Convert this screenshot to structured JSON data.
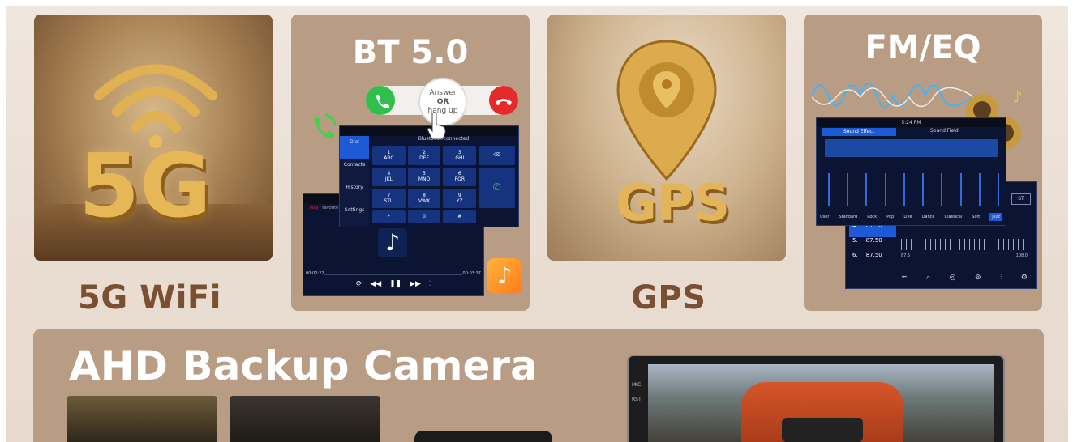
{
  "cards": {
    "wifi": {
      "big_text": "5G",
      "caption": "5G WiFi"
    },
    "bt": {
      "title": "BT 5.0",
      "answer_line1": "Answer",
      "answer_line2": "OR",
      "answer_line3": "hang up",
      "dial_header": "Bluetooth connected",
      "side_items": [
        "Dial",
        "Contacts",
        "History",
        "Settings"
      ],
      "keys": [
        {
          "num": "1",
          "letters": "ABC"
        },
        {
          "num": "2",
          "letters": "DEF"
        },
        {
          "num": "3",
          "letters": "GHI"
        },
        {
          "num": "4",
          "letters": "JKL"
        },
        {
          "num": "5",
          "letters": "MNO"
        },
        {
          "num": "6",
          "letters": "PQR"
        },
        {
          "num": "7",
          "letters": "STU"
        },
        {
          "num": "8",
          "letters": "VWX"
        },
        {
          "num": "9",
          "letters": "YZ"
        },
        {
          "num": "*",
          "letters": ""
        },
        {
          "num": "0",
          "letters": ""
        },
        {
          "num": "#",
          "letters": ""
        }
      ],
      "music_tabs": [
        "Play",
        "Favorite"
      ],
      "music_time_start": "00:00:22",
      "music_time_end": "00:03:37"
    },
    "gps": {
      "letters": "GPS",
      "caption": "GPS"
    },
    "fm": {
      "title": "FM/EQ",
      "eq_time": "5:24 PM",
      "eq_tab_active": "Sound Effect",
      "eq_tab_other": "Sound Field",
      "presets": [
        "User",
        "Standard",
        "Rock",
        "Pop",
        "Live",
        "Dance",
        "Classical",
        "Soft",
        "Jazz"
      ],
      "stereo": "ST",
      "freq_rows": [
        {
          "n": "4.",
          "f": "87.50"
        },
        {
          "n": "5.",
          "f": "87.50"
        },
        {
          "n": "6.",
          "f": "87.50"
        }
      ],
      "scale_start": "87.5",
      "scale_end": "108.0"
    },
    "ahd": {
      "title": "AHD Backup Camera",
      "monitor_labels": [
        "MIC",
        "RST"
      ]
    }
  },
  "colors": {
    "caption": "#7a4f32",
    "card_bg": "#b89c84",
    "accent_blue": "#1d5bd6",
    "gold": "#e3b45a"
  }
}
